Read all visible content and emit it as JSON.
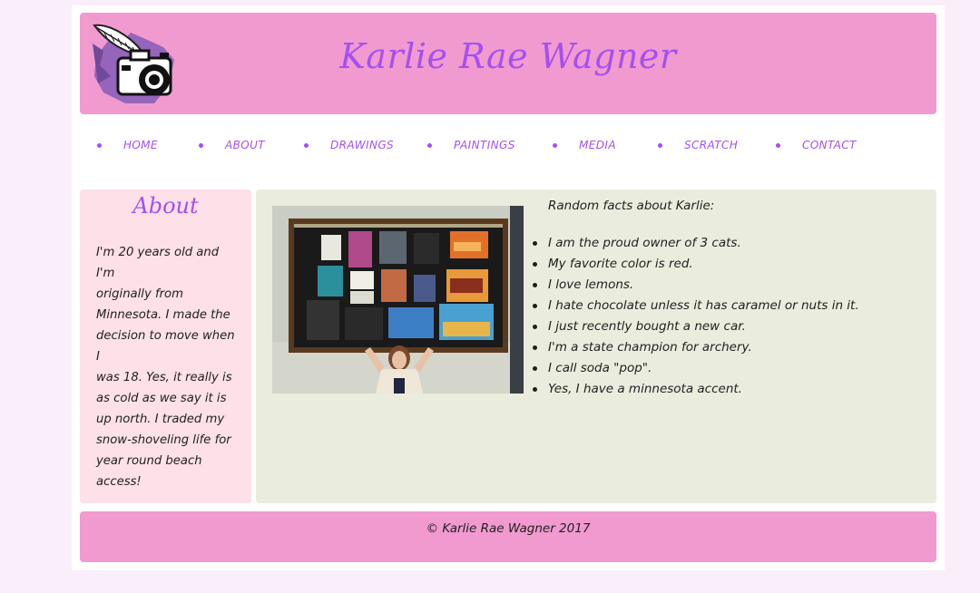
{
  "colors": {
    "background": "#fbeefb",
    "page": "#ffffff",
    "header": "#f19acf",
    "accent": "#a54ff3",
    "sidebar": "#fde0e8",
    "main": "#eaecdd",
    "text": "#1f1f1f"
  },
  "header": {
    "title": "Karlie Rae Wagner",
    "logo_icon": "camera-feather-icon"
  },
  "nav": {
    "items": [
      {
        "label": "HOME"
      },
      {
        "label": "ABOUT"
      },
      {
        "label": "DRAWINGS"
      },
      {
        "label": "PAINTINGS"
      },
      {
        "label": "MEDIA"
      },
      {
        "label": "SCRATCH"
      },
      {
        "label": "CONTACT"
      }
    ]
  },
  "sidebar": {
    "title": "About",
    "lines": [
      "I'm 20 years old and I'm",
      "originally from",
      "Minnesota. I made the",
      "decision to move when I",
      "was 18. Yes, it really is",
      "as cold as we say it is",
      "up north. I traded my",
      "snow-shoveling life for",
      "year round beach access!"
    ]
  },
  "main": {
    "photo_icon": "artwork-display-photo",
    "facts_heading": "Random facts about Karlie:",
    "facts": [
      "I am the proud owner of 3 cats.",
      "My favorite color is red.",
      "I love lemons.",
      "I hate chocolate unless it has caramel or nuts in it.",
      "I just recently bought a new car.",
      "I'm a state champion for archery.",
      "I call soda \"pop\".",
      "Yes, I have a minnesota accent."
    ]
  },
  "footer": {
    "text": "© Karlie Rae Wagner 2017"
  }
}
